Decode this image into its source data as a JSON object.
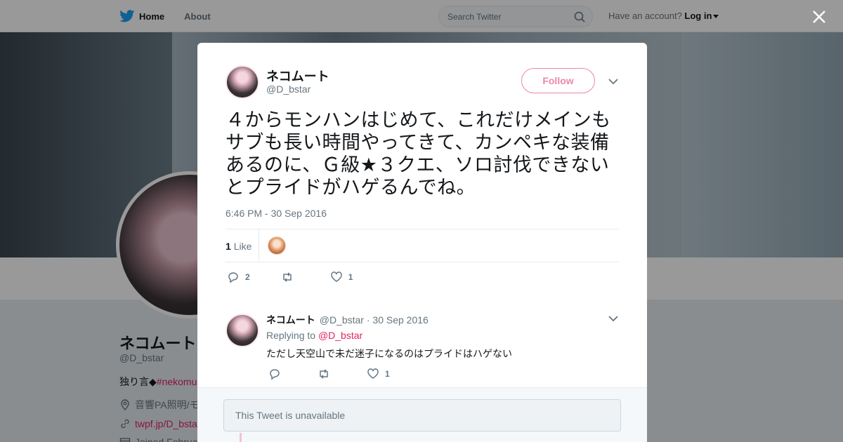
{
  "nav": {
    "home_label": "Home",
    "about_label": "About",
    "search_placeholder": "Search Twitter",
    "account_prompt": "Have an account?",
    "login_label": "Log in"
  },
  "background_profile": {
    "name": "ネコムート",
    "handle": "@D_bstar",
    "bio_prefix": "独り言◆",
    "bio_tag": "#nekomu",
    "location": "音響PA照明/モ",
    "link": "twpf.jp/D_bsta",
    "joined": "Joined Februa"
  },
  "tweet": {
    "author_name": "ネコムート",
    "author_handle": "@D_bstar",
    "follow_label": "Follow",
    "text": "４からモンハンはじめて、これだけメインもサブも長い時間やってきて、カンペキな装備あるのに、Ｇ級★３クエ、ソロ討伐できないとプライドがハゲるんでね。",
    "timestamp": "6:46 PM - 30 Sep 2016",
    "likes_count": "1",
    "likes_label": "Like",
    "reply_count": "2",
    "retweet_count": "",
    "like_count_action": "1"
  },
  "reply": {
    "author_name": "ネコムート",
    "author_handle": "@D_bstar",
    "date": "· 30 Sep 2016",
    "replying_prefix": "Replying to",
    "replying_to": "@D_bstar",
    "text": "ただし天空山で未だ迷子になるのはプライドはハゲない",
    "reply_count": "",
    "retweet_count": "",
    "like_count": "1"
  },
  "unavailable": {
    "text": "This Tweet is unavailable"
  },
  "colors": {
    "accent": "#e0245e",
    "twitter_blue": "#1da1f2"
  }
}
